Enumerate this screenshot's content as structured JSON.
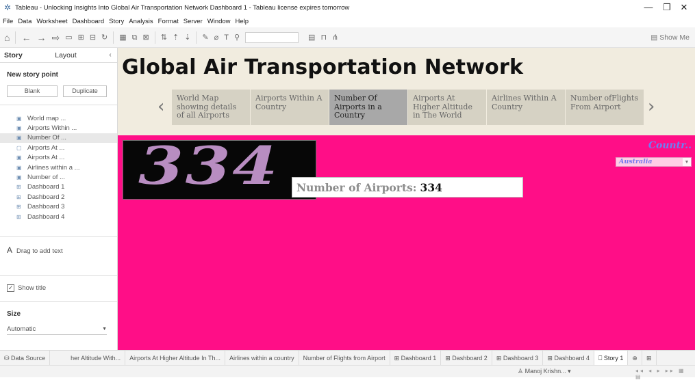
{
  "window": {
    "title": "Tableau - Unlocking Insights Into Global Air Transportation Network Dashboard 1 - Tableau license expires tomorrow",
    "app_icon": "tableau-icon",
    "controls": [
      "—",
      "❐",
      "✕"
    ]
  },
  "menu": [
    "File",
    "Data",
    "Worksheet",
    "Dashboard",
    "Story",
    "Analysis",
    "Format",
    "Server",
    "Window",
    "Help"
  ],
  "toolbar": {
    "show_me_label": "Show Me"
  },
  "sidebar": {
    "tabs": [
      "Story",
      "Layout"
    ],
    "new_story_point": "New story point",
    "blank_label": "Blank",
    "duplicate_label": "Duplicate",
    "items": [
      "World map ...",
      "Airports Within ...",
      "Number Of ...",
      "Airports At ...",
      "Airports At ...",
      "Airlines within a ...",
      "Number of ...",
      "Dashboard 1",
      "Dashboard 2",
      "Dashboard 3",
      "Dashboard 4"
    ],
    "drag_text": "Drag to add text",
    "show_title": "Show title",
    "size_heading": "Size",
    "size_value": "Automatic"
  },
  "story": {
    "title": "Global Air Transportation Network",
    "points": [
      "World Map showing details of all Airports",
      "Airports Within A Country",
      "Number Of Airports in a Country",
      "Airports At Higher Altitude in The World",
      "Airlines Within A Country",
      "Number ofFlights From Airport"
    ],
    "active_index": 2
  },
  "viz": {
    "big_number": "334",
    "tooltip_label": "Number of Airports:",
    "tooltip_value": "334",
    "filter_title": "Countr..",
    "filter_value": "Australia",
    "background_color": "#ff0e87",
    "number_color": "#b88dc1"
  },
  "bottom_tabs": [
    "Data Source",
    "her Altitude With...",
    "Airports At Higher Altitude In Th...",
    "Airlines within a country",
    "Number of  Flights from Airport",
    "Dashboard 1",
    "Dashboard 2",
    "Dashboard 3",
    "Dashboard 4",
    "Story 1"
  ],
  "status": {
    "user": "Manoj Krishn..."
  }
}
